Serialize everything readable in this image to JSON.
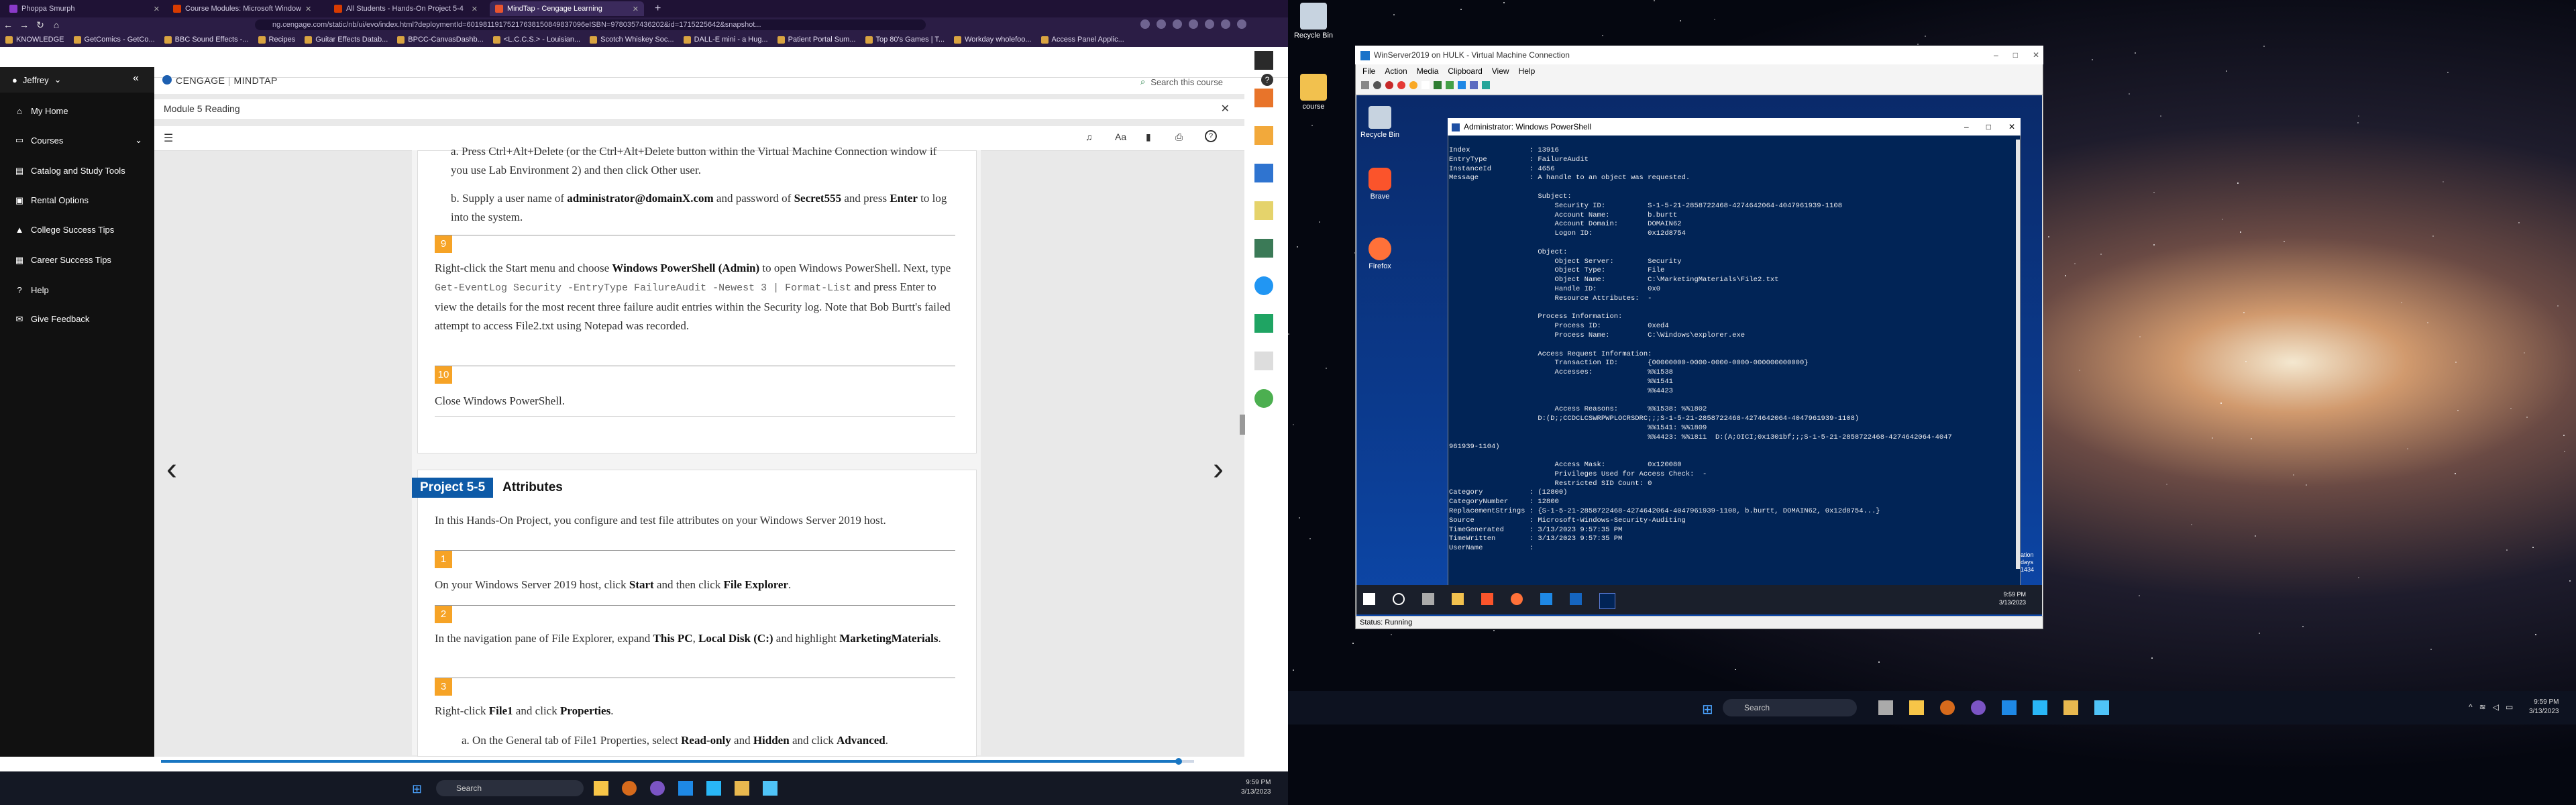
{
  "browser": {
    "tabs": [
      {
        "label": "Phoppa Smurph",
        "color": "#8a3ac9"
      },
      {
        "label": "Course Modules: Microsoft Window",
        "color": "#d83b01"
      },
      {
        "label": "All Students - Hands-On Project 5-4",
        "color": "#d83b01"
      },
      {
        "label": "MindTap - Cengage Learning",
        "color": "#e8542f"
      }
    ],
    "new_tab": "+",
    "url": "ng.cengage.com/static/nb/ui/evo/index.html?deploymentId=60198119175217638150849837096eISBN=9780357436202&id=1715225642&snapshot...",
    "bookmarks": [
      "KNOWLEDGE",
      "GetComics - GetCo...",
      "BBC Sound Effects -...",
      "Recipes",
      "Guitar Effects Datab...",
      "BPCC-CanvasDashb...",
      "<L.C.C.S.> - Louisian...",
      "Scotch Whiskey Soc...",
      "DALL-E mini - a Hug...",
      "Patient Portal Sum...",
      "Top 80's Games | T...",
      "Workday wholefoo...",
      "Access Panel Applic..."
    ]
  },
  "cengage": {
    "user": "Jeffrey",
    "brand": "CENGAGE",
    "product": "MINDTAP",
    "search_placeholder": "Search this course",
    "module_title": "Module 5 Reading",
    "nav": [
      "My Home",
      "Courses",
      "Catalog and Study Tools",
      "Rental Options",
      "College Success Tips",
      "Career Success Tips",
      "Help",
      "Give Feedback"
    ],
    "step_a_text": "a. Press Ctrl+Alt+Delete (or the Ctrl+Alt+Delete button within the Virtual Machine Connection window if you use Lab Environment 2) and then click Other user.",
    "step_b_pre": "b. Supply a user name of ",
    "step_b_user": "administrator@domainX.com",
    "step_b_mid": " and password of ",
    "step_b_pass": "Secret555",
    "step_b_and": " and press ",
    "step_b_enter": "Enter",
    "step_b_post": " to log into the system.",
    "step9_num": "9",
    "step9_pre": "Right-click the Start menu and choose ",
    "step9_bold": "Windows PowerShell (Admin)",
    "step9_mid": " to open Windows PowerShell. Next, type ",
    "step9_code": "Get-EventLog Security -EntryType FailureAudit -Newest 3 | Format-List",
    "step9_post": " and press Enter to view the details for the most recent three failure audit entries within the Security log. Note that Bob Burtt's failed attempt to access File2.txt using Notepad was recorded.",
    "step10_num": "10",
    "step10_text": "Close Windows PowerShell.",
    "project_badge": "Project 5-5",
    "project_title": "Attributes",
    "project_intro": "In this Hands-On Project, you configure and test file attributes on your Windows Server 2019 host.",
    "p1_num": "1",
    "p1_pre": "On your Windows Server 2019 host, click ",
    "p1_b1": "Start",
    "p1_mid": " and then click ",
    "p1_b2": "File Explorer",
    "p1_post": ".",
    "p2_num": "2",
    "p2_pre": "In the navigation pane of File Explorer, expand ",
    "p2_b1": "This PC",
    "p2_m1": ", ",
    "p2_b2": "Local Disk (C:)",
    "p2_m2": " and highlight ",
    "p2_b3": "MarketingMaterials",
    "p2_post": ".",
    "p3_num": "3",
    "p3_pre": "Right-click ",
    "p3_b1": "File1",
    "p3_mid": " and click ",
    "p3_b2": "Properties",
    "p3_post": ".",
    "p3a_pre": "a. On the General tab of File1 Properties, select ",
    "p3a_b1": "Read-only",
    "p3a_m1": " and ",
    "p3a_b2": "Hidden",
    "p3a_m2": " and click ",
    "p3a_b3": "Advanced",
    "p3a_post": ".",
    "reading_progress": 0.985
  },
  "left_taskbar": {
    "search": "Search",
    "time": "9:59 PM",
    "date": "3/13/2023"
  },
  "desktop": {
    "recycle_bin": "Recycle Bin",
    "course": "course"
  },
  "vm": {
    "title": "WinServer2019 on HULK - Virtual Machine Connection",
    "menu": [
      "File",
      "Action",
      "Media",
      "Clipboard",
      "View",
      "Help"
    ],
    "status": "Status: Running",
    "guest_icons": [
      "Recycle Bin",
      "Brave",
      "Firefox"
    ],
    "ps_title": "Administrator: Windows PowerShell",
    "ps_output": "Index              : 13916\nEntryType          : FailureAudit\nInstanceId         : 4656\nMessage            : A handle to an object was requested.\n\n                     Subject:\n                         Security ID:          S-1-5-21-2858722468-4274642064-4047961939-1108\n                         Account Name:         b.burtt\n                         Account Domain:       DOMAIN62\n                         Logon ID:             0x12d8754\n\n                     Object:\n                         Object Server:        Security\n                         Object Type:          File\n                         Object Name:          C:\\MarketingMaterials\\File2.txt\n                         Handle ID:            0x0\n                         Resource Attributes:  -\n\n                     Process Information:\n                         Process ID:           0xed4\n                         Process Name:         C:\\Windows\\explorer.exe\n\n                     Access Request Information:\n                         Transaction ID:       {00000000-0000-0000-0000-000000000000}\n                         Accesses:             %%1538\n                                               %%1541\n                                               %%4423\n\n                         Access Reasons:       %%1538: %%1802\n                     D:(D;;CCDCLCSWRPWPLOCRSDRC;;;S-1-5-21-2858722468-4274642064-4047961939-1108)\n                                               %%1541: %%1809\n                                               %%4423: %%1811  D:(A;OICI;0x1301bf;;;S-1-5-21-2858722468-4274642064-4047\n961939-1104)\n\n                         Access Mask:          0x120080\n                         Privileges Used for Access Check:  -\n                         Restricted SID Count: 0\nCategory           : (12800)\nCategoryNumber     : 12800\nReplacementStrings : {S-1-5-21-2858722468-4274642064-4047961939-1108, b.burtt, DOMAIN62, 0x12d8754...}\nSource             : Microsoft-Windows-Security-Auditing\nTimeGenerated      : 3/13/2023 9:57:35 PM\nTimeWritten        : 3/13/2023 9:57:35 PM\nUserName           :",
    "guest_time": "9:59 PM",
    "guest_date": "3/13/2023",
    "activation_text": "ation\ndays\n1434"
  },
  "right_taskbar": {
    "search": "Search",
    "time": "9:59 PM",
    "date": "3/13/2023"
  }
}
